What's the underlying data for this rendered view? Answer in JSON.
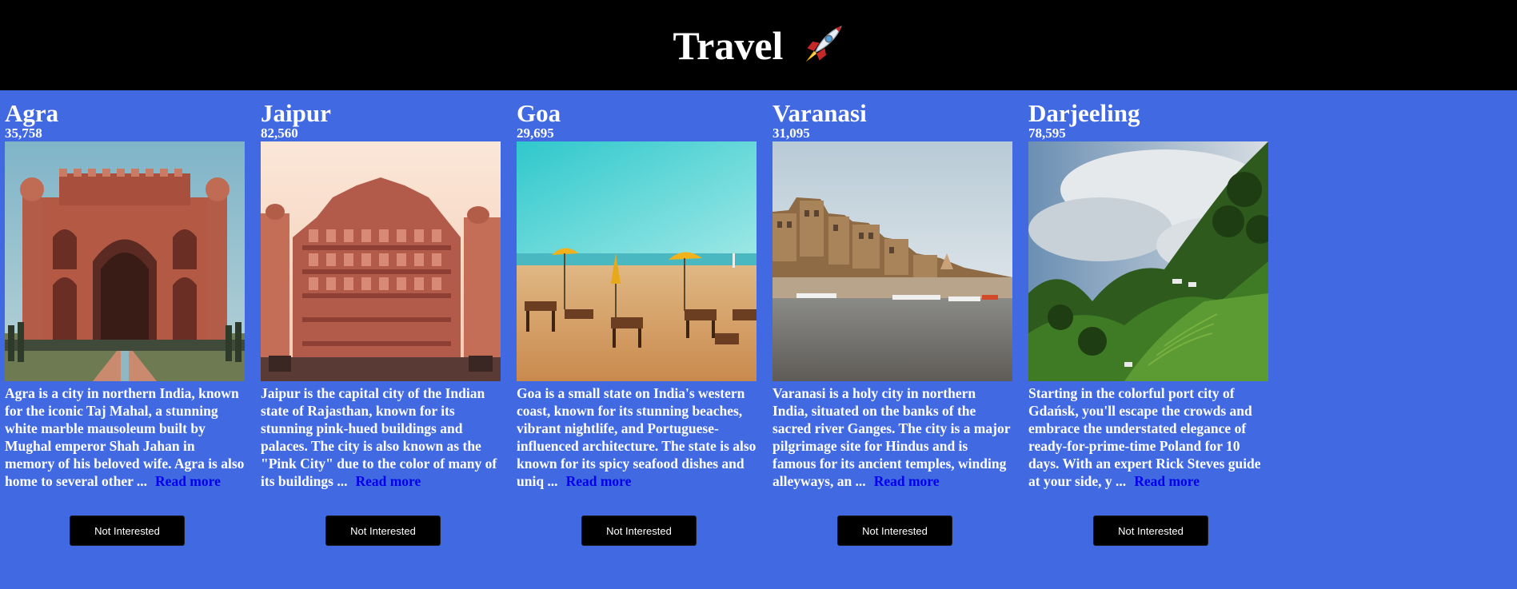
{
  "header": {
    "title": "Travel",
    "icon": "rocket-icon"
  },
  "cards": [
    {
      "name": "Agra",
      "count": "35,758",
      "description": "Agra is a city in northern India, known for the iconic Taj Mahal, a stunning white marble mausoleum built by Mughal emperor Shah Jahan in memory of his beloved wife. Agra is also home to several other ...",
      "read_more": "Read more",
      "button": "Not Interested"
    },
    {
      "name": "Jaipur",
      "count": "82,560",
      "description": "Jaipur is the capital city of the Indian state of Rajasthan, known for its stunning pink-hued buildings and palaces. The city is also known as the \"Pink City\" due to the color of many of its buildings ...",
      "read_more": "Read more",
      "button": "Not Interested"
    },
    {
      "name": "Goa",
      "count": "29,695",
      "description": "Goa is a small state on India's western coast, known for its stunning beaches, vibrant nightlife, and Portuguese-influenced architecture. The state is also known for its spicy seafood dishes and uniq ...",
      "read_more": "Read more",
      "button": "Not Interested"
    },
    {
      "name": "Varanasi",
      "count": "31,095",
      "description": "Varanasi is a holy city in northern India, situated on the banks of the sacred river Ganges. The city is a major pilgrimage site for Hindus and is famous for its ancient temples, winding alleyways, an ...",
      "read_more": "Read more",
      "button": "Not Interested"
    },
    {
      "name": "Darjeeling",
      "count": "78,595",
      "description": "Starting in the colorful port city of Gdańsk, you'll escape the crowds and embrace the understated elegance of ready-for-prime-time Poland for 10 days. With an expert Rick Steves guide at your side, y ...",
      "read_more": "Read more",
      "button": "Not Interested"
    }
  ],
  "colors": {
    "page_background": "#4169e1",
    "header_background": "#000000",
    "link": "#0000ee",
    "button_background": "#000000"
  }
}
